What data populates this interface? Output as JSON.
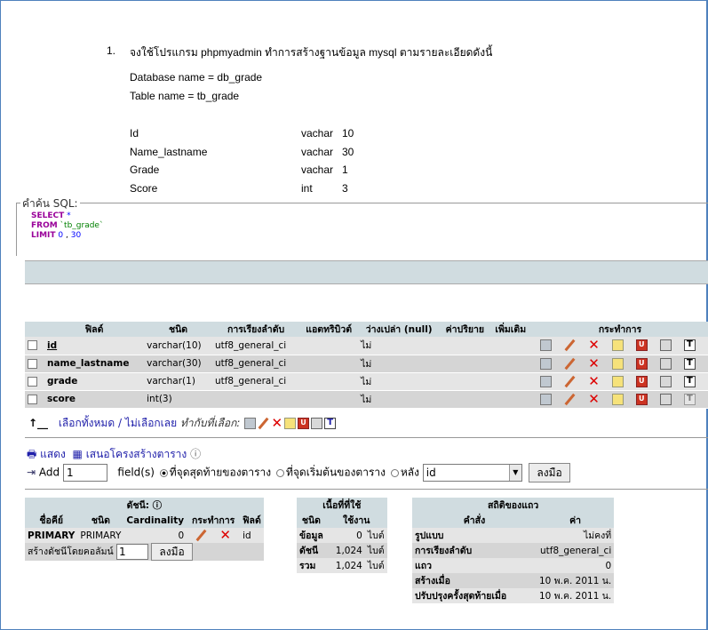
{
  "document": {
    "number": "1.",
    "instruction": "จงใช้โปรแกรม phpmyadmin ทำการสร้างฐานข้อมูล mysql ตามรายละเอียดดังนี้",
    "database_line": "Database name = db_grade",
    "table_line": "Table name = tb_grade",
    "fields": [
      {
        "name": "Id",
        "type": "vachar",
        "len": "10"
      },
      {
        "name": "Name_lastname",
        "type": "vachar",
        "len": "30"
      },
      {
        "name": "Grade",
        "type": "vachar",
        "len": "1"
      },
      {
        "name": "Score",
        "type": "int",
        "len": "3"
      }
    ]
  },
  "sql": {
    "legend": "คำค้น SQL:",
    "select": "SELECT",
    "star": " *",
    "from": "FROM",
    "table": " `tb_grade`",
    "limit": "LIMIT",
    "limit_start": " 0",
    "limit_sep": " , ",
    "limit_count": "30"
  },
  "structure": {
    "headers": [
      "ฟิลด์",
      "ชนิด",
      "การเรียงลำดับ",
      "แอตทริบิวต์",
      "ว่างเปล่า (null)",
      "ค่าปริยาย",
      "เพิ่มเติม",
      "กระทำการ"
    ],
    "rows": [
      {
        "field": "id",
        "type": "varchar(10)",
        "collation": "utf8_general_ci",
        "attributes": "",
        "null": "ไม่",
        "default": "",
        "extra": ""
      },
      {
        "field": "name_lastname",
        "type": "varchar(30)",
        "collation": "utf8_general_ci",
        "attributes": "",
        "null": "ไม่",
        "default": "",
        "extra": ""
      },
      {
        "field": "grade",
        "type": "varchar(1)",
        "collation": "utf8_general_ci",
        "attributes": "",
        "null": "ไม่",
        "default": "",
        "extra": ""
      },
      {
        "field": "score",
        "type": "int(3)",
        "collation": "",
        "attributes": "",
        "null": "ไม่",
        "default": "",
        "extra": ""
      }
    ],
    "check_all": "เลือกทั้งหมด",
    "separator": " / ",
    "uncheck_all": "ไม่เลือกเลย",
    "with_selected": "ทำกับที่เลือก:"
  },
  "links": {
    "print_view": "แสดง",
    "relation_view": "เสนอโครงสร้างตาราง"
  },
  "add_fields": {
    "label": "Add",
    "count": "1",
    "fields_label": "field(s)",
    "opt_end": "ที่จุดสุดท้ายของตาราง",
    "opt_begin": "ที่จุดเริ่มต้นของตาราง",
    "opt_after": "หลัง",
    "after_field": "id",
    "go": "ลงมือ"
  },
  "indexes": {
    "title": "ดัชนี:",
    "headers": [
      "ชื่อคีย์",
      "ชนิด",
      "Cardinality",
      "กระทำการ",
      "ฟิลด์"
    ],
    "row": {
      "keyname": "PRIMARY",
      "type": "PRIMARY",
      "cardinality": "0",
      "field": "id"
    },
    "create_label": "สร้างดัชนีโดยคอลัมน์",
    "create_count": "1",
    "go": "ลงมือ"
  },
  "space_usage": {
    "title": "เนื้อที่ที่ใช้",
    "headers": [
      "ชนิด",
      "ใช้งาน"
    ],
    "rows": [
      {
        "type": "ข้อมูล",
        "value": "0",
        "unit": "ไบต์"
      },
      {
        "type": "ดัชนี",
        "value": "1,024",
        "unit": "ไบต์"
      },
      {
        "type": "รวม",
        "value": "1,024",
        "unit": "ไบต์"
      }
    ]
  },
  "row_stats": {
    "title": "สถิติของแถว",
    "headers": [
      "คำสั่ง",
      "ค่า"
    ],
    "rows": [
      {
        "label": "รูปแบบ",
        "value": "ไม่คงที่"
      },
      {
        "label": "การเรียงลำดับ",
        "value": "utf8_general_ci"
      },
      {
        "label": "แถว",
        "value": "0"
      },
      {
        "label": "สร้างเมื่อ",
        "value": "10 พ.ค. 2011 น."
      },
      {
        "label": "ปรับปรุงครั้งสุดท้ายเมื่อ",
        "value": "10 พ.ค. 2011 น."
      }
    ]
  },
  "colors": {
    "header_bg": "#d0dce0",
    "row_odd": "#e5e5e5",
    "row_even": "#d5d5d5",
    "link": "#2020aa",
    "sql_keyword": "#990099",
    "delete_icon": "#dd0000"
  }
}
